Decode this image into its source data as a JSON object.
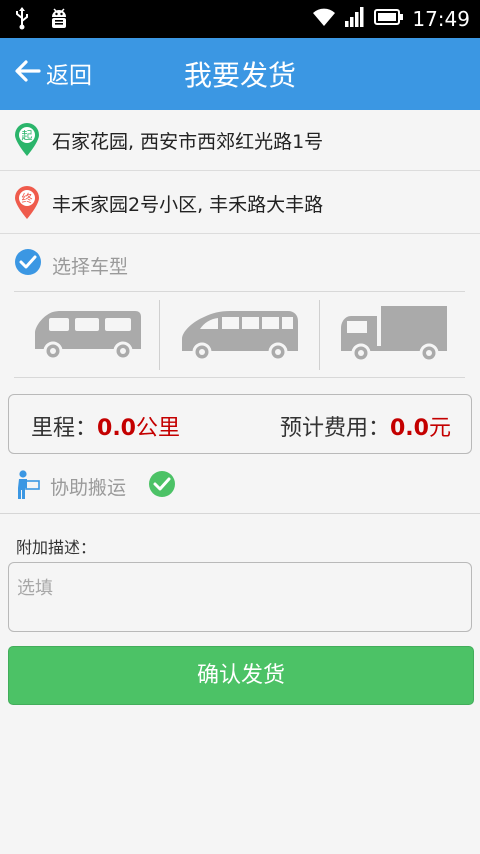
{
  "status_bar": {
    "time": "17:49",
    "left_icons": [
      "usb-icon",
      "android-debug-icon"
    ],
    "right_icons": [
      "wifi-icon",
      "signal-icon",
      "battery-icon"
    ]
  },
  "header": {
    "back_label": "返回",
    "title": "我要发货",
    "background": "#3b97e3"
  },
  "addresses": {
    "start": {
      "badge": "起",
      "text": "石家花园, 西安市西郊红光路1号",
      "color": "#2bb56b"
    },
    "end": {
      "badge": "终",
      "text": "丰禾家园2号小区, 丰禾路大丰路",
      "color": "#ef5b4c"
    }
  },
  "vehicle": {
    "label": "选择车型",
    "types": [
      {
        "icon": "van-icon"
      },
      {
        "icon": "minibus-icon"
      },
      {
        "icon": "truck-icon"
      }
    ]
  },
  "estimate": {
    "distance_label": "里程：",
    "distance_value": "0.0",
    "distance_unit": "公里",
    "cost_label": "预计费用：",
    "cost_value": "0.0",
    "cost_unit": "元",
    "value_color": "#c40000"
  },
  "assist": {
    "label": "协助搬运",
    "checked": true
  },
  "description": {
    "label": "附加描述：",
    "placeholder": "选填"
  },
  "submit": {
    "label": "确认发货",
    "color": "#4cc266"
  }
}
